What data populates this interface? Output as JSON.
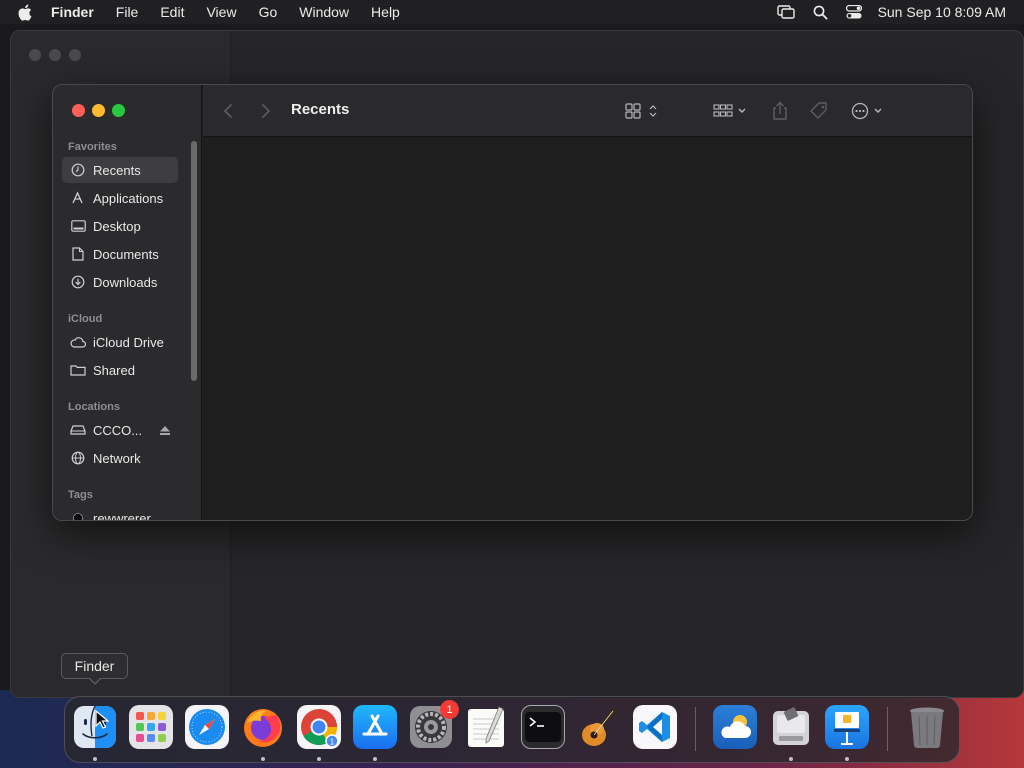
{
  "menubar": {
    "app_name": "Finder",
    "items": [
      "File",
      "Edit",
      "View",
      "Go",
      "Window",
      "Help"
    ],
    "clock": "Sun Sep 10  8:09 AM"
  },
  "finder": {
    "title": "Recents",
    "sidebar": {
      "favorites_header": "Favorites",
      "favorites": [
        "Recents",
        "Applications",
        "Desktop",
        "Documents",
        "Downloads"
      ],
      "icloud_header": "iCloud",
      "icloud": [
        "iCloud Drive",
        "Shared"
      ],
      "locations_header": "Locations",
      "locations": [
        "CCCO...",
        "Network"
      ],
      "tags_header": "Tags",
      "tags": [
        "rewwrerer"
      ]
    }
  },
  "tooltip": {
    "text": "Finder"
  },
  "dock": {
    "apps": [
      "finder",
      "launchpad",
      "safari",
      "firefox",
      "chrome",
      "app-store",
      "system-settings",
      "textedit",
      "terminal",
      "garageband",
      "vscode",
      "weather",
      "migration-assistant",
      "keynote",
      "trash"
    ],
    "system_settings_badge": "1"
  },
  "colors": {
    "close": "#fe5f57",
    "minimize": "#febc2e",
    "maximize": "#28c840",
    "badge": "#f03a33"
  }
}
